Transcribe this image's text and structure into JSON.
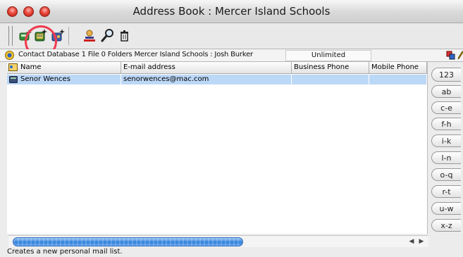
{
  "window": {
    "title": "Address Book : Mercer Island Schools"
  },
  "infobar": {
    "text": "Contact Database   1 File  0 Folders   Mercer Island Schools : Josh Burker",
    "limit": "Unlimited"
  },
  "table": {
    "columns": [
      "Name",
      "E-mail address",
      "Business Phone",
      "Mobile Phone"
    ],
    "rows": [
      {
        "name": "Senor Wences",
        "email": "senorwences@mac.com",
        "business_phone": "",
        "mobile_phone": ""
      }
    ]
  },
  "alpha_tabs": [
    "123",
    "ab",
    "c-e",
    "f-h",
    "i-k",
    "l-n",
    "o-q",
    "r-t",
    "u-w",
    "x-z"
  ],
  "status": {
    "text": "Creates a new personal mail list."
  },
  "icons": {
    "toolbar": [
      "new-contact-icon",
      "new-mail-list-icon",
      "new-group-icon",
      "directory-icon",
      "search-icon",
      "trash-icon"
    ]
  }
}
